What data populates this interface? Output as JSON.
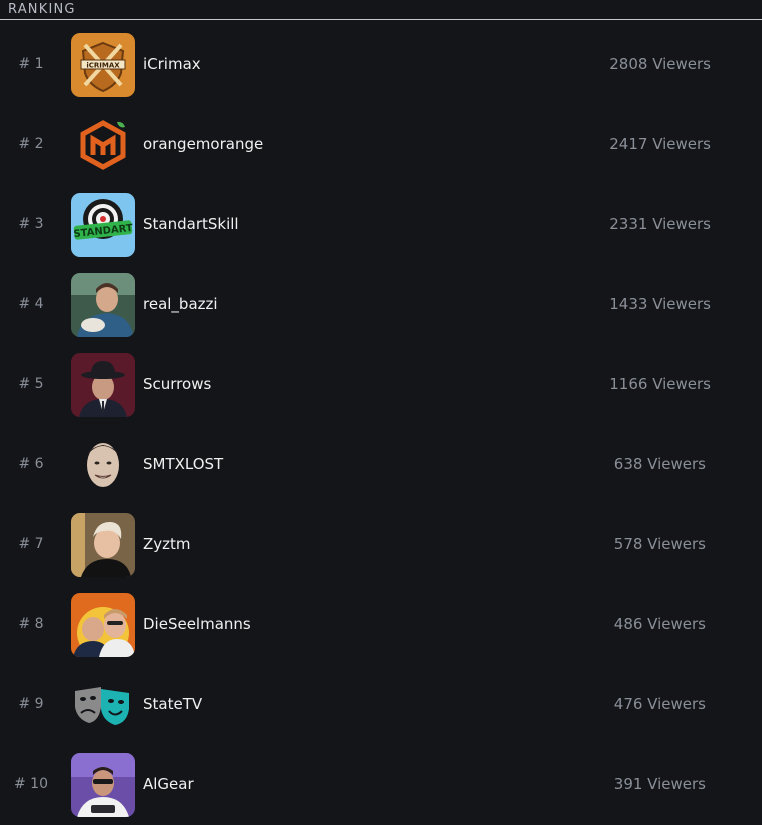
{
  "header": {
    "title": "RANKING"
  },
  "ranking": [
    {
      "rank": "# 1",
      "name": "iCrimax",
      "viewers": "2808 Viewers",
      "avatar": "icrimax-logo"
    },
    {
      "rank": "# 2",
      "name": "orangemorange",
      "viewers": "2417 Viewers",
      "avatar": "orange-m-logo"
    },
    {
      "rank": "# 3",
      "name": "StandartSkill",
      "viewers": "2331 Viewers",
      "avatar": "dartboard-logo",
      "avatar_text": "STANDART"
    },
    {
      "rank": "# 4",
      "name": "real_bazzi",
      "viewers": "1433 Viewers",
      "avatar": "person-photo"
    },
    {
      "rank": "# 5",
      "name": "Scurrows",
      "viewers": "1166 Viewers",
      "avatar": "hat-man-illustration"
    },
    {
      "rank": "# 6",
      "name": "SMTXLOST",
      "viewers": "638 Viewers",
      "avatar": "face-cutout"
    },
    {
      "rank": "# 7",
      "name": "Zyztm",
      "viewers": "578 Viewers",
      "avatar": "person-photo"
    },
    {
      "rank": "# 8",
      "name": "DieSeelmanns",
      "viewers": "486 Viewers",
      "avatar": "two-people-photo"
    },
    {
      "rank": "# 9",
      "name": "StateTV",
      "viewers": "476 Viewers",
      "avatar": "theater-masks-logo"
    },
    {
      "rank": "# 10",
      "name": "AlGear",
      "viewers": "391 Viewers",
      "avatar": "person-photo"
    }
  ]
}
